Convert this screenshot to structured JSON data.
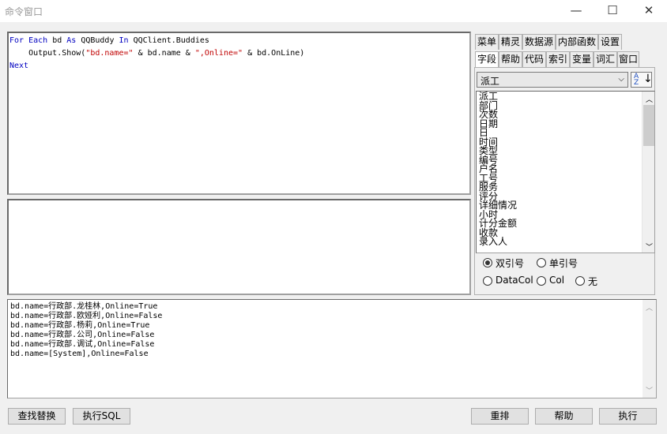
{
  "window": {
    "title": "命令窗口",
    "minimize": "—",
    "maximize": "☐",
    "close": "✕"
  },
  "editor": {
    "lines": [
      [
        {
          "t": "For Each",
          "k": "kw"
        },
        {
          "t": " bd "
        },
        {
          "t": "As",
          "k": "kw"
        },
        {
          "t": " QQBuddy "
        },
        {
          "t": "In",
          "k": "kw"
        },
        {
          "t": " QQClient.Buddies"
        }
      ],
      [
        {
          "t": "    Output.Show("
        },
        {
          "t": "\"bd.name=\"",
          "k": "str"
        },
        {
          "t": " & bd.name & "
        },
        {
          "t": "\",Online=\"",
          "k": "str"
        },
        {
          "t": " & bd.OnLine)"
        }
      ],
      [
        {
          "t": "Next",
          "k": "kw"
        }
      ]
    ]
  },
  "output": {
    "lines": [
      "bd.name=行政部.龙桂林,Online=True",
      "bd.name=行政部.欧娅利,Online=False",
      "bd.name=行政部.杨莉,Online=True",
      "bd.name=行政部.公司,Online=False",
      "bd.name=行政部.调试,Online=False",
      "bd.name=[System],Online=False"
    ]
  },
  "tabs_row1": [
    "菜单",
    "精灵",
    "数据源",
    "内部函数",
    "设置"
  ],
  "tabs_row2": [
    "字段",
    "帮助",
    "代码",
    "索引",
    "变量",
    "词汇",
    "窗口"
  ],
  "active_tab": "字段",
  "field_select": {
    "value": "派工",
    "sort_icon": "sort-az-icon"
  },
  "field_list": [
    "派工",
    "部门",
    "次数",
    "日期",
    "日",
    "时间",
    "类型",
    "编号",
    "户名",
    "工号",
    "服务",
    "评分",
    "详细情况",
    "小时",
    "计分金额",
    "收款",
    "录入人"
  ],
  "quote_options": [
    {
      "label": "双引号",
      "checked": true
    },
    {
      "label": "单引号",
      "checked": false
    }
  ],
  "col_options": [
    {
      "label": "DataCol",
      "checked": false
    },
    {
      "label": "Col",
      "checked": false
    },
    {
      "label": "无",
      "checked": false
    }
  ],
  "buttons": {
    "find_replace": "查找替换",
    "exec_sql": "执行SQL",
    "reorder": "重排",
    "help": "帮助",
    "execute": "执行"
  }
}
